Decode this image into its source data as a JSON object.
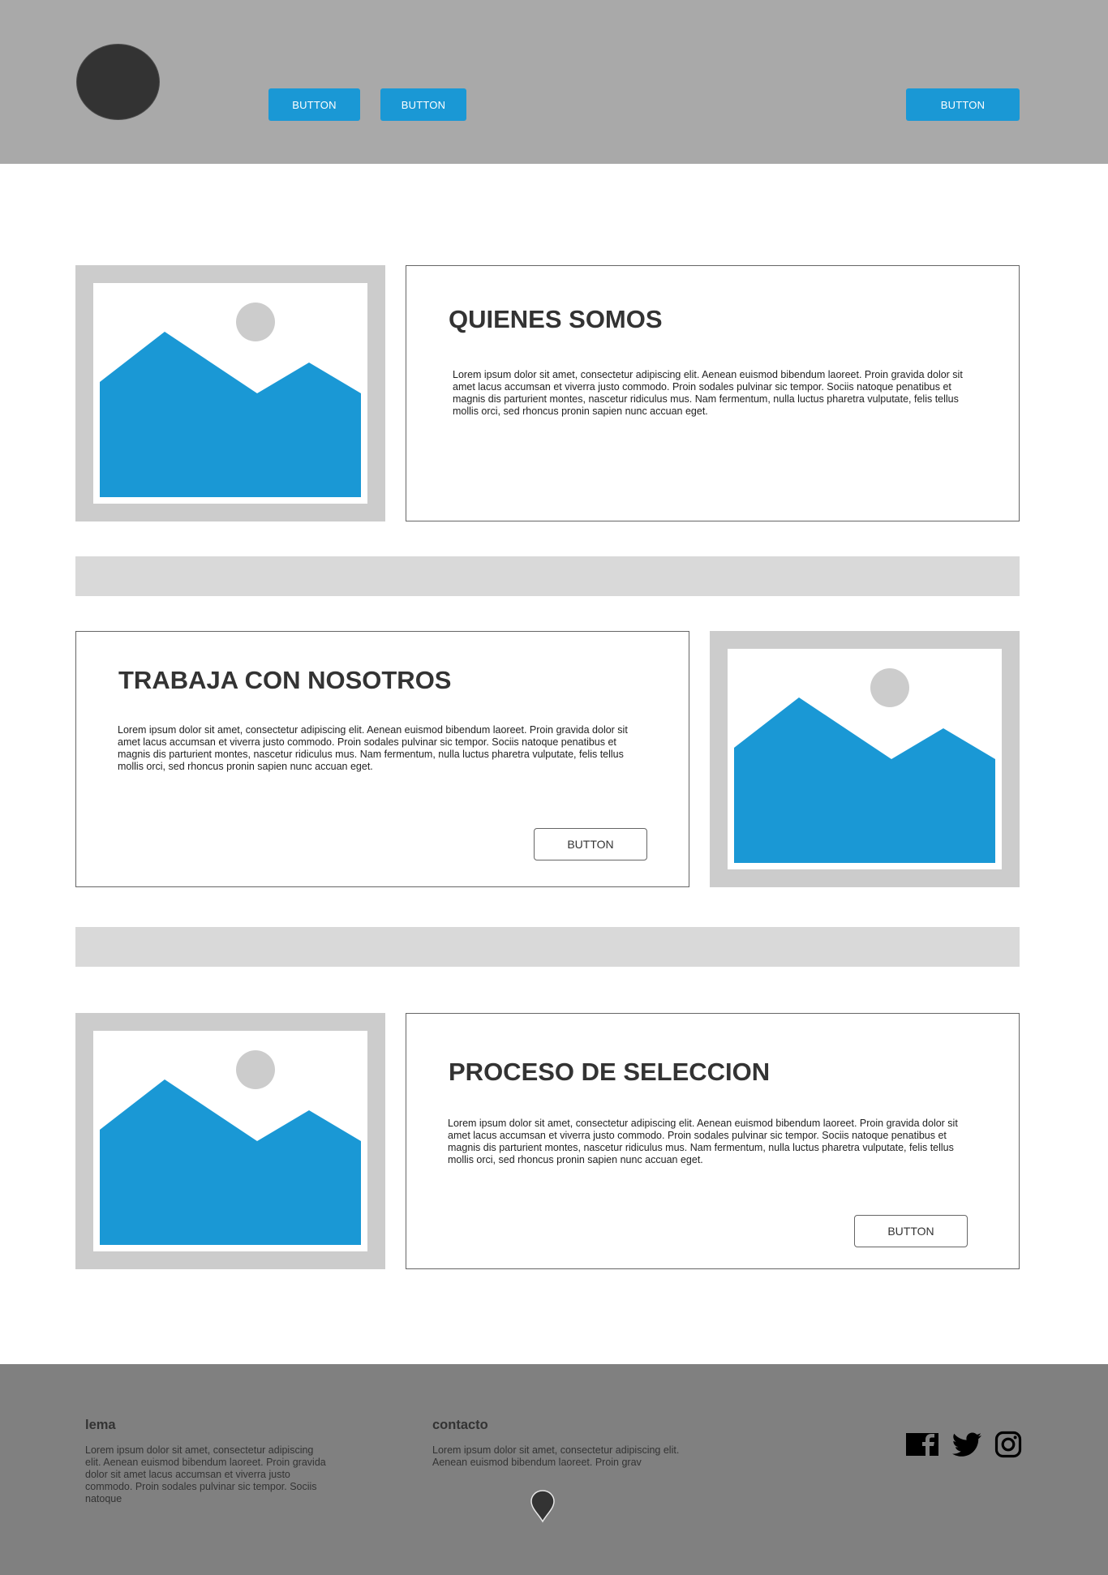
{
  "header": {
    "nav_buttons": [
      "BUTTON",
      "BUTTON"
    ],
    "cta_button": "BUTTON"
  },
  "sections": [
    {
      "title": "QUIENES SOMOS",
      "text": "Lorem ipsum dolor sit amet, consectetur adipiscing elit. Aenean euismod bibendum laoreet. Proin gravida dolor sit amet lacus accumsan et viverra justo commodo. Proin sodales pulvinar sic tempor. Sociis natoque penatibus et magnis dis parturient montes, nascetur ridiculus mus. Nam fermentum, nulla luctus pharetra vulputate, felis tellus mollis orci, sed rhoncus pronin sapien nunc accuan eget."
    },
    {
      "title": "TRABAJA CON NOSOTROS",
      "text": "Lorem ipsum dolor sit amet, consectetur adipiscing elit. Aenean euismod bibendum laoreet. Proin gravida dolor sit amet lacus accumsan et viverra justo commodo. Proin sodales pulvinar sic tempor. Sociis natoque penatibus et magnis dis parturient montes, nascetur ridiculus mus. Nam fermentum, nulla luctus pharetra vulputate, felis tellus mollis orci, sed rhoncus pronin sapien nunc accuan eget.",
      "button": "BUTTON"
    },
    {
      "title": "PROCESO DE SELECCION",
      "text": "Lorem ipsum dolor sit amet, consectetur adipiscing elit. Aenean euismod bibendum laoreet. Proin gravida dolor sit amet lacus accumsan et viverra justo commodo. Proin sodales pulvinar sic tempor. Sociis natoque penatibus et magnis dis parturient montes, nascetur ridiculus mus. Nam fermentum, nulla luctus pharetra vulputate, felis tellus mollis orci, sed rhoncus pronin sapien nunc accuan eget.",
      "button": "BUTTON"
    }
  ],
  "footer": {
    "lema": {
      "title": "lema",
      "text": "Lorem ipsum dolor sit amet, consectetur adipiscing elit. Aenean euismod bibendum laoreet. Proin gravida dolor sit amet lacus accumsan et viverra justo commodo. Proin sodales pulvinar sic tempor. Sociis natoque"
    },
    "contacto": {
      "title": "contacto",
      "text": "Lorem ipsum dolor sit amet, consectetur adipiscing elit. Aenean euismod bibendum laoreet. Proin grav"
    },
    "social_icons": [
      "facebook-icon",
      "twitter-icon",
      "instagram-icon"
    ],
    "location_icon": "map-pin-icon"
  },
  "colors": {
    "header_bg": "#a9a9a9",
    "accent_blue": "#1a98d5",
    "image_frame": "#cccccc",
    "divider": "#d9d9d9",
    "footer_bg": "#808080"
  }
}
